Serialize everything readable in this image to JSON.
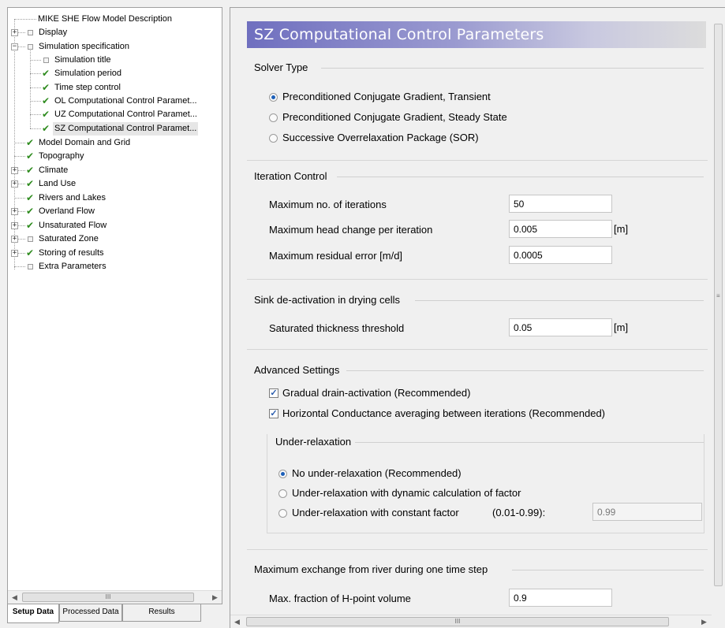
{
  "tree": {
    "items": [
      {
        "label": "MIKE SHE Flow Model Description",
        "state": "none",
        "expander": ""
      },
      {
        "label": "Display",
        "state": "box",
        "expander": "+"
      },
      {
        "label": "Simulation specification",
        "state": "box",
        "expander": "−"
      },
      {
        "label": "Simulation title",
        "state": "box",
        "expander": ""
      },
      {
        "label": "Simulation period",
        "state": "check",
        "expander": ""
      },
      {
        "label": "Time step control",
        "state": "check",
        "expander": ""
      },
      {
        "label": "OL Computational Control Paramet...",
        "state": "check",
        "expander": ""
      },
      {
        "label": "UZ Computational Control Paramet...",
        "state": "check",
        "expander": ""
      },
      {
        "label": "SZ Computational Control Paramet...",
        "state": "check",
        "expander": ""
      },
      {
        "label": "Model Domain and Grid",
        "state": "check",
        "expander": ""
      },
      {
        "label": "Topography",
        "state": "check",
        "expander": ""
      },
      {
        "label": "Climate",
        "state": "check",
        "expander": "+"
      },
      {
        "label": "Land Use",
        "state": "check",
        "expander": "+"
      },
      {
        "label": "Rivers and Lakes",
        "state": "check",
        "expander": ""
      },
      {
        "label": "Overland Flow",
        "state": "check",
        "expander": "+"
      },
      {
        "label": "Unsaturated Flow",
        "state": "check",
        "expander": "+"
      },
      {
        "label": "Saturated Zone",
        "state": "box",
        "expander": "+"
      },
      {
        "label": "Storing of results",
        "state": "check",
        "expander": "+"
      },
      {
        "label": "Extra Parameters",
        "state": "box",
        "expander": ""
      }
    ],
    "scroll_grip": "III",
    "arrow_left": "◀",
    "arrow_right": "▶"
  },
  "tabs": [
    "Setup Data",
    "Processed Data",
    "Results"
  ],
  "main": {
    "title": "SZ Computational Control Parameters",
    "solver": {
      "title": "Solver Type",
      "options": [
        "Preconditioned Conjugate Gradient, Transient",
        "Preconditioned Conjugate Gradient, Steady State",
        "Successive Overrelaxation Package (SOR)"
      ],
      "selected": 0
    },
    "iteration": {
      "title": "Iteration Control",
      "max_iter_label": "Maximum no. of iterations",
      "max_iter_value": "50",
      "max_head_label": "Maximum head change per iteration",
      "max_head_value": "0.005",
      "max_head_unit": "[m]",
      "max_resid_label": "Maximum residual error [m/d]",
      "max_resid_value": "0.0005"
    },
    "sink": {
      "title": "Sink de-activation in drying cells",
      "thickness_label": "Saturated thickness threshold",
      "thickness_value": "0.05",
      "thickness_unit": "[m]"
    },
    "advanced": {
      "title": "Advanced Settings",
      "drain_label": "Gradual drain-activation (Recommended)",
      "drain_checked": true,
      "horiz_label": "Horizontal Conductance averaging between iterations (Recommended)",
      "horiz_checked": true,
      "underrelax_title": "Under-relaxation",
      "underrelax_options": [
        "No under-relaxation (Recommended)",
        "Under-relaxation with dynamic calculation of factor",
        "Under-relaxation with constant factor"
      ],
      "underrelax_range": "(0.01-0.99):",
      "underrelax_selected": 0,
      "factor_value": "0.99"
    },
    "river": {
      "title": "Maximum exchange from river during one time step",
      "fraction_label": "Max. fraction of H-point volume",
      "fraction_value": "0.9"
    },
    "bottom_scroll_grip": "III",
    "vscroll_grip": "≡"
  }
}
